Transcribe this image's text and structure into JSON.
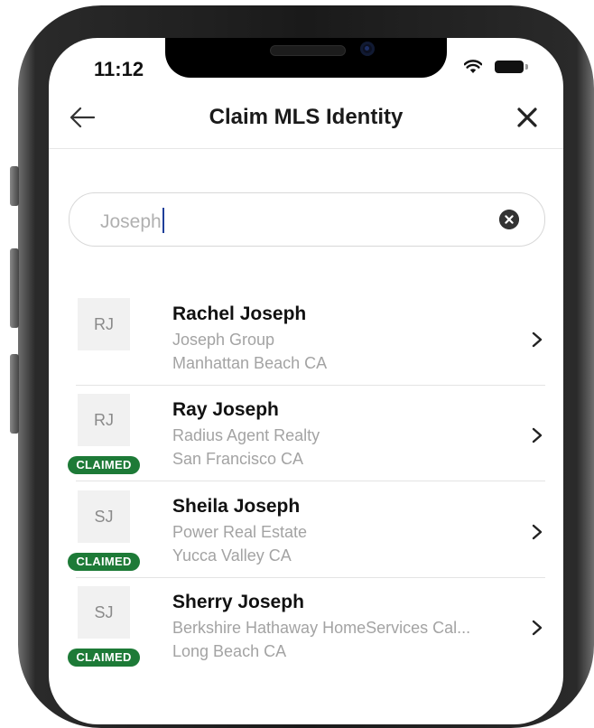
{
  "status_bar": {
    "time": "11:12",
    "wifi_icon": "wifi-icon",
    "battery_icon": "battery-icon"
  },
  "nav": {
    "title": "Claim MLS Identity",
    "back_icon": "arrow-left-icon",
    "close_icon": "close-icon"
  },
  "search": {
    "value": "Joseph",
    "clear_icon": "clear-circle-icon"
  },
  "colors": {
    "claimed_badge": "#1d7a37",
    "caret": "#1f3f9a",
    "secondary_text": "#a3a3a3"
  },
  "results": [
    {
      "initials": "RJ",
      "name": "Rachel Joseph",
      "brokerage": "Joseph Group",
      "location": "Manhattan Beach CA",
      "claimed": false
    },
    {
      "initials": "RJ",
      "name": "Ray Joseph",
      "brokerage": "Radius Agent Realty",
      "location": "San Francisco CA",
      "claimed": true,
      "badge": "CLAIMED"
    },
    {
      "initials": "SJ",
      "name": "Sheila Joseph",
      "brokerage": "Power Real Estate",
      "location": "Yucca Valley CA",
      "claimed": true,
      "badge": "CLAIMED"
    },
    {
      "initials": "SJ",
      "name": "Sherry Joseph",
      "brokerage": "Berkshire Hathaway HomeServices Cal...",
      "location": "Long Beach CA",
      "claimed": true,
      "badge": "CLAIMED"
    }
  ]
}
